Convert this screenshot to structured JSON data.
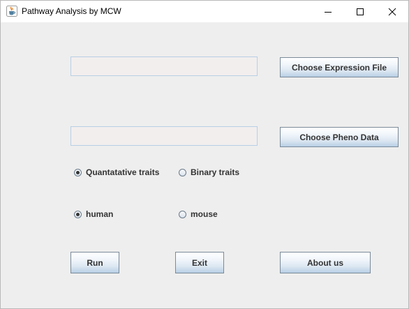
{
  "window": {
    "title": "Pathway Analysis by MCW",
    "icon": "java-cup-icon",
    "controls": [
      "minimize-icon",
      "maximize-icon",
      "close-icon"
    ]
  },
  "expression": {
    "value": "",
    "button_label": "Choose Expression File"
  },
  "pheno": {
    "value": "",
    "button_label": "Choose Pheno Data"
  },
  "trait_type": {
    "options": [
      {
        "label": "Quantatative traits",
        "checked": true
      },
      {
        "label": "Binary traits",
        "checked": false
      }
    ]
  },
  "species": {
    "options": [
      {
        "label": "human",
        "checked": true
      },
      {
        "label": "mouse",
        "checked": false
      }
    ]
  },
  "actions": {
    "run_label": "Run",
    "exit_label": "Exit",
    "about_label": "About us"
  },
  "colors": {
    "window_bg": "#eeeeee",
    "field_border": "#b8cfe5",
    "button_gradient_bottom": "#b8cfe5"
  }
}
